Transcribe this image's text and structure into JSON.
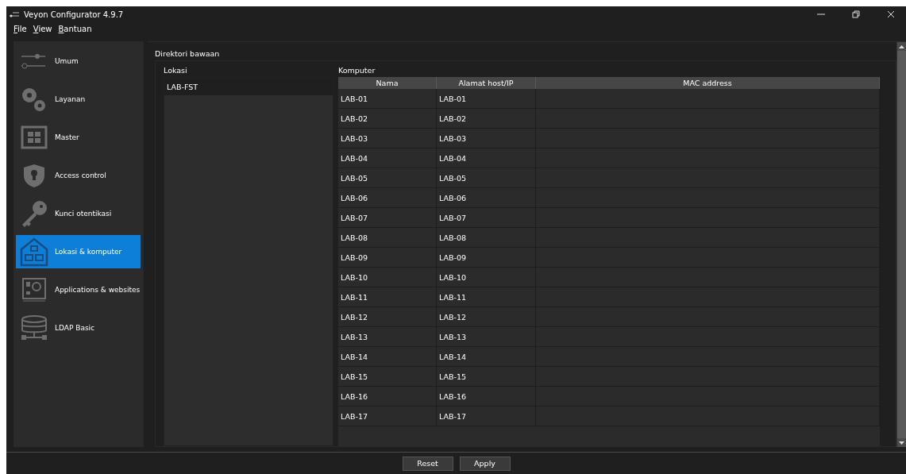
{
  "window": {
    "title": "Veyon Configurator 4.9.7"
  },
  "menu": [
    "File",
    "View",
    "Bantuan"
  ],
  "sidebar": {
    "items": [
      {
        "label": "Umum",
        "selected": false
      },
      {
        "label": "Layanan",
        "selected": false
      },
      {
        "label": "Master",
        "selected": false
      },
      {
        "label": "Access control",
        "selected": false
      },
      {
        "label": "Kunci otentikasi",
        "selected": false
      },
      {
        "label": "Lokasi & komputer",
        "selected": true
      },
      {
        "label": "Applications & websites",
        "selected": false
      },
      {
        "label": "LDAP Basic",
        "selected": false
      }
    ]
  },
  "group_title": "Direktori bawaan",
  "locations": {
    "title": "Lokasi",
    "items": [
      {
        "label": "LAB-FST",
        "selected": false
      }
    ]
  },
  "computers": {
    "title": "Komputer",
    "columns": [
      "Nama",
      "Alamat host/IP",
      "MAC address"
    ],
    "rows": [
      [
        "LAB-01",
        "LAB-01"
      ],
      [
        "LAB-02",
        "LAB-02"
      ],
      [
        "LAB-03",
        "LAB-03"
      ],
      [
        "LAB-04",
        "LAB-04"
      ],
      [
        "LAB-05",
        "LAB-05"
      ],
      [
        "LAB-06",
        "LAB-06"
      ],
      [
        "LAB-07",
        "LAB-07"
      ],
      [
        "LAB-08",
        "LAB-08"
      ],
      [
        "LAB-09",
        "LAB-09"
      ],
      [
        "LAB-10",
        "LAB-10"
      ],
      [
        "LAB-11",
        "LAB-11"
      ],
      [
        "LAB-12",
        "LAB-12"
      ],
      [
        "LAB-13",
        "LAB-13"
      ],
      [
        "LAB-14",
        "LAB-14"
      ],
      [
        "LAB-15",
        "LAB-15"
      ],
      [
        "LAB-16",
        "LAB-16"
      ],
      [
        "LAB-17",
        "LAB-17"
      ]
    ]
  },
  "buttons": [
    "Reset",
    "Apply"
  ]
}
